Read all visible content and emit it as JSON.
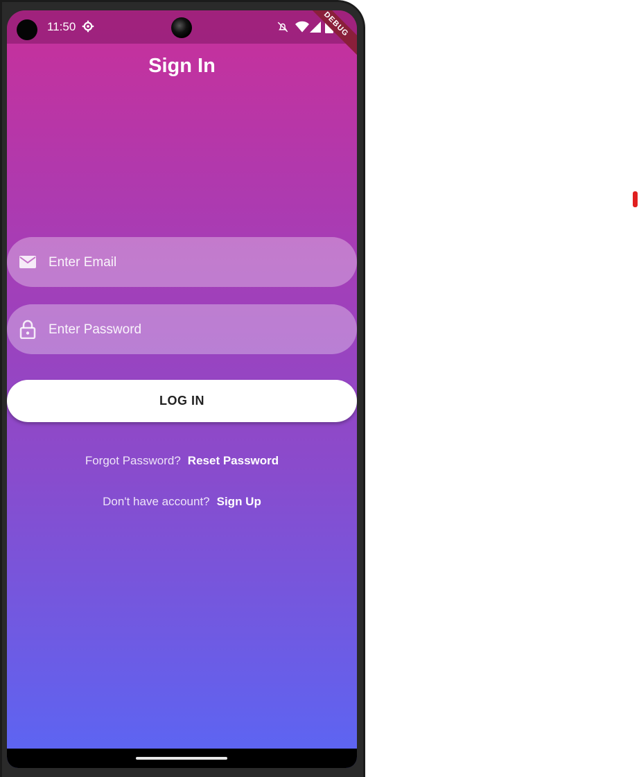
{
  "status_bar": {
    "time": "11:50"
  },
  "debug_banner": "DEBUG",
  "page": {
    "title": "Sign In"
  },
  "form": {
    "email_placeholder": "Enter Email",
    "password_placeholder": "Enter Password",
    "login_label": "LOG IN"
  },
  "links": {
    "forgot_text": "Forgot Password?",
    "reset_label": "Reset Password",
    "no_account_text": "Don't have account?",
    "signup_label": "Sign Up"
  },
  "colors": {
    "gradient_top": "#c8309a",
    "gradient_bottom": "#5a66f4",
    "button_bg": "#ffffff",
    "ribbon": "#8a1f3a"
  },
  "icons": [
    "gear-icon",
    "bell-off-icon",
    "wifi-icon",
    "signal-icon",
    "battery-icon",
    "mail-icon",
    "lock-icon"
  ]
}
